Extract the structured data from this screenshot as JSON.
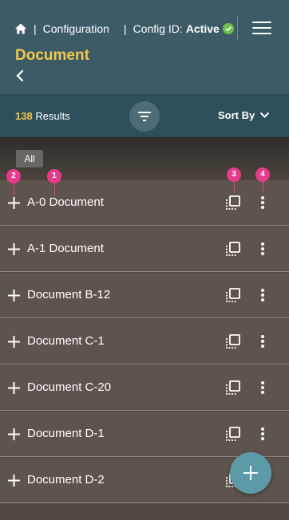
{
  "header": {
    "breadcrumb": "Configuration",
    "separator": "|",
    "config_label": "Config ID:",
    "config_status": "Active",
    "page_title": "Document"
  },
  "results": {
    "count": "138",
    "label": "Results",
    "sort_label": "Sort By"
  },
  "chip": {
    "label": "All"
  },
  "rows": [
    {
      "label": "A-0 Document"
    },
    {
      "label": "A-1 Document"
    },
    {
      "label": "Document B-12"
    },
    {
      "label": "Document C-1"
    },
    {
      "label": "Document C-20"
    },
    {
      "label": "Document D-1"
    },
    {
      "label": "Document D-2"
    }
  ],
  "callouts": [
    "1",
    "2",
    "3",
    "4"
  ],
  "icons": {
    "home": "home-icon",
    "status": "check-circle-icon",
    "menu": "hamburger-menu-icon",
    "back": "chevron-left-icon",
    "filter": "filter-icon",
    "sort": "chevron-down-icon",
    "expand": "plus-icon",
    "copy": "copy-icon",
    "more": "kebab-menu-icon",
    "add": "plus-icon"
  },
  "colors": {
    "header_bg": "#3c5b66",
    "results_bg": "#2d4f5b",
    "title": "#f2c84b",
    "status_green": "#6cc24a",
    "callout": "#e83a8c",
    "fab": "#5d9aa8"
  }
}
